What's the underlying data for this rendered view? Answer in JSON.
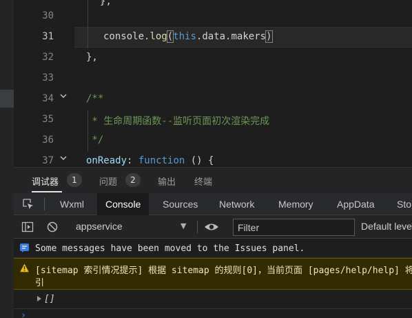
{
  "editor": {
    "line_numbers": [
      "30",
      "31",
      "32",
      "33",
      "34",
      "35",
      "36",
      "37"
    ],
    "active_line": "31",
    "line31": {
      "obj": "console",
      "dot": ".",
      "fn": "log",
      "open": "(",
      "this": "this",
      "rest": ".data.makers",
      "close": ")"
    },
    "line32": "},",
    "line34": "/**",
    "line35": " * 生命周期函数--监听页面初次渲染完成",
    "line36": " */",
    "line37": {
      "key": "onReady",
      "colon": ": ",
      "kw": "function",
      "rest": " () {"
    }
  },
  "panel_tabs": [
    {
      "label": "调试器",
      "badge": "1"
    },
    {
      "label": "问题",
      "badge": "2"
    },
    {
      "label": "输出"
    },
    {
      "label": "终端"
    }
  ],
  "dev_tabs": [
    "Wxml",
    "Console",
    "Sources",
    "Network",
    "Memory",
    "AppData",
    "Storage"
  ],
  "dev_active": "Console",
  "toolbar": {
    "context": "appservice",
    "filter_placeholder": "Filter",
    "levels": "Default levels"
  },
  "messages": {
    "info": "Some messages have been moved to the Issues panel.",
    "warn_line1": "[sitemap 索引情况提示] 根据 sitemap 的规则[0]，当前页面 [pages/help/help] 将被索",
    "warn_line2": "引",
    "log": "[]"
  },
  "prompt": "›",
  "colors": {
    "accent": "#4a8fe7",
    "warn_bg": "#332b00",
    "warn_icon": "#f0c000"
  }
}
